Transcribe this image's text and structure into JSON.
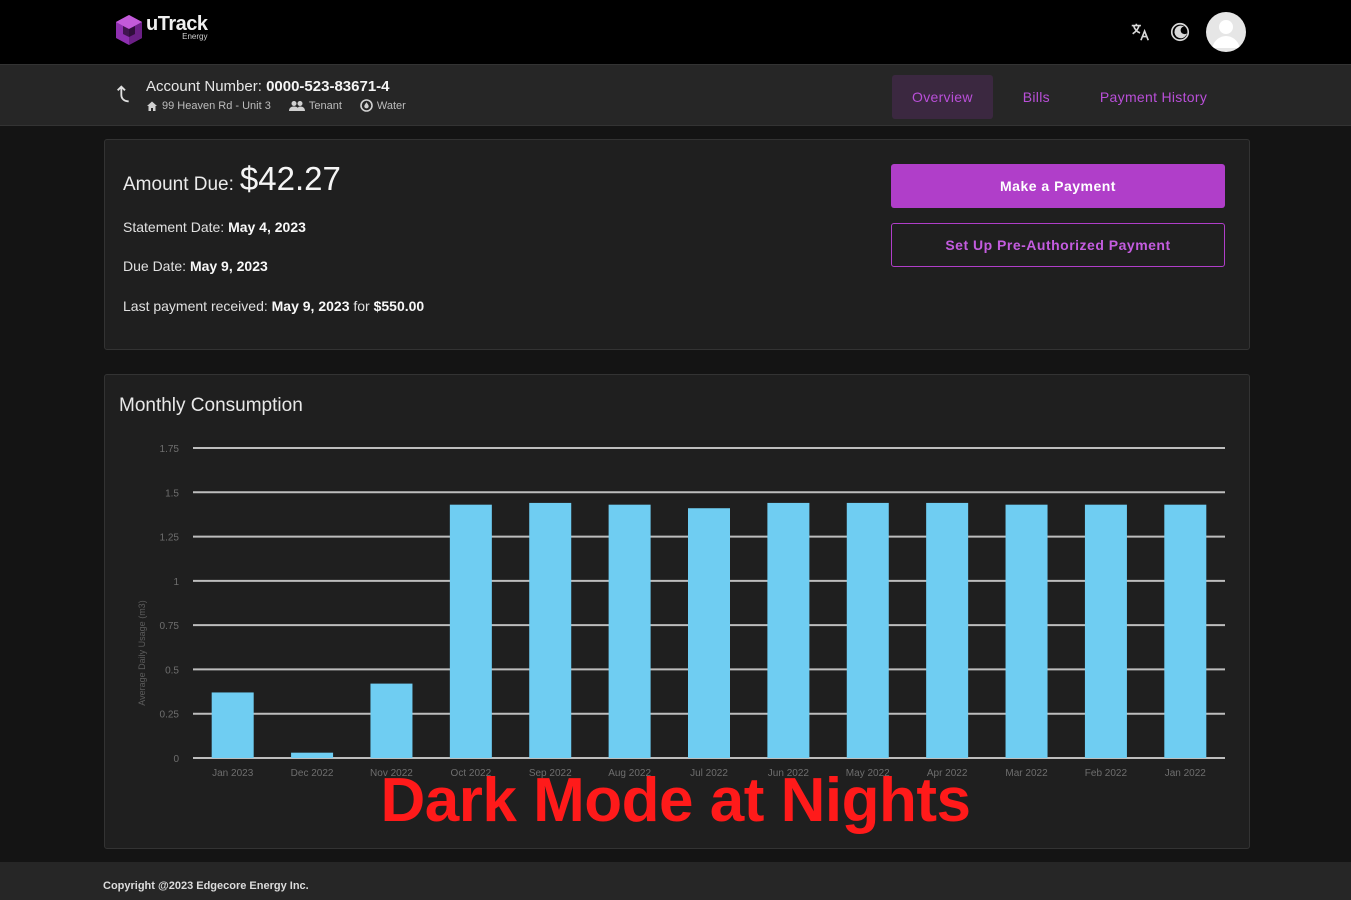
{
  "brand": {
    "name": "uTrack",
    "sub": "Energy"
  },
  "header_icons": [
    "translate-icon",
    "dark-mode-icon",
    "avatar"
  ],
  "account": {
    "label": "Account Number:",
    "number": "0000-523-83671-4",
    "address": "99 Heaven Rd - Unit 3",
    "role": "Tenant",
    "service": "Water"
  },
  "tabs": [
    {
      "label": "Overview",
      "active": true
    },
    {
      "label": "Bills",
      "active": false
    },
    {
      "label": "Payment History",
      "active": false
    }
  ],
  "billing": {
    "amount_label": "Amount Due:",
    "amount": "$42.27",
    "statement_label": "Statement Date:",
    "statement_date": "May 4, 2023",
    "due_label": "Due Date:",
    "due_date": "May 9, 2023",
    "last_label": "Last payment received:",
    "last_date": "May 9, 2023",
    "for_label": "for",
    "last_amount": "$550.00",
    "pay_button": "Make a Payment",
    "preauth_button": "Set Up Pre-Authorized Payment"
  },
  "chart_title": "Monthly Consumption",
  "chart_data": {
    "type": "bar",
    "title": "Monthly Consumption",
    "xlabel": "",
    "ylabel": "Average Daily Usage (m3)",
    "ylim": [
      0,
      1.75
    ],
    "yticks": [
      "0",
      "0.25",
      "0.5",
      "0.75",
      "1",
      "1.25",
      "1.5",
      "1.75"
    ],
    "grid": true,
    "categories": [
      "Jan 2023",
      "Dec 2022",
      "Nov 2022",
      "Oct 2022",
      "Sep 2022",
      "Aug 2022",
      "Jul 2022",
      "Jun 2022",
      "May 2022",
      "Apr 2022",
      "Mar 2022",
      "Feb 2022",
      "Jan 2022"
    ],
    "values": [
      0.37,
      0.03,
      0.42,
      1.43,
      1.44,
      1.43,
      1.41,
      1.44,
      1.44,
      1.44,
      1.43,
      1.43,
      1.43
    ],
    "color": "#6fcdf2"
  },
  "overlay_text": "Dark Mode at Nights",
  "footer": "Copyright @2023 Edgecore Energy Inc.",
  "colors": {
    "accent": "#b03ec9",
    "bar": "#6fcdf2",
    "overlay": "#ff1a1a"
  }
}
